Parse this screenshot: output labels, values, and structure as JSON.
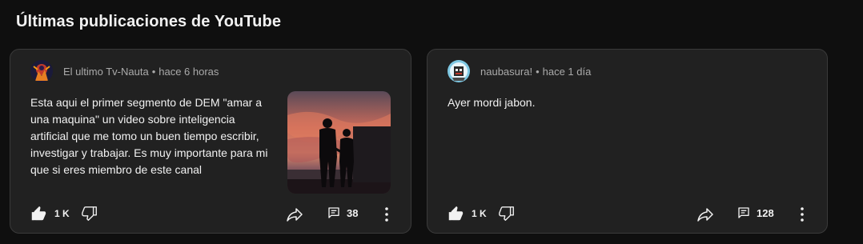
{
  "section": {
    "title": "Últimas publicaciones de YouTube"
  },
  "posts": [
    {
      "author": "El ultimo Tv-Nauta",
      "time": "hace 6 horas",
      "text": "Esta aqui el primer segmento de DEM \"amar a una maquina\" un video sobre inteligencia artificial que me tomo un buen tiempo escribir, investigar y trabajar. Es muy importante para mi que si eres miembro de este canal",
      "likes": "1 K",
      "comments": "38",
      "has_image": true
    },
    {
      "author": "naubasura!",
      "time": "hace 1 día",
      "text": "Ayer mordi jabon.",
      "likes": "1 K",
      "comments": "128",
      "has_image": false
    }
  ],
  "icons": {
    "like": "thumbs-up-icon",
    "dislike": "thumbs-down-icon",
    "share": "share-icon",
    "comments": "comments-icon",
    "more": "more-vertical-icon"
  },
  "colors": {
    "background": "#0f0f0f",
    "card": "#212121",
    "border": "#3a3a3a",
    "text": "#f1f1f1",
    "meta": "#aaaaaa"
  }
}
